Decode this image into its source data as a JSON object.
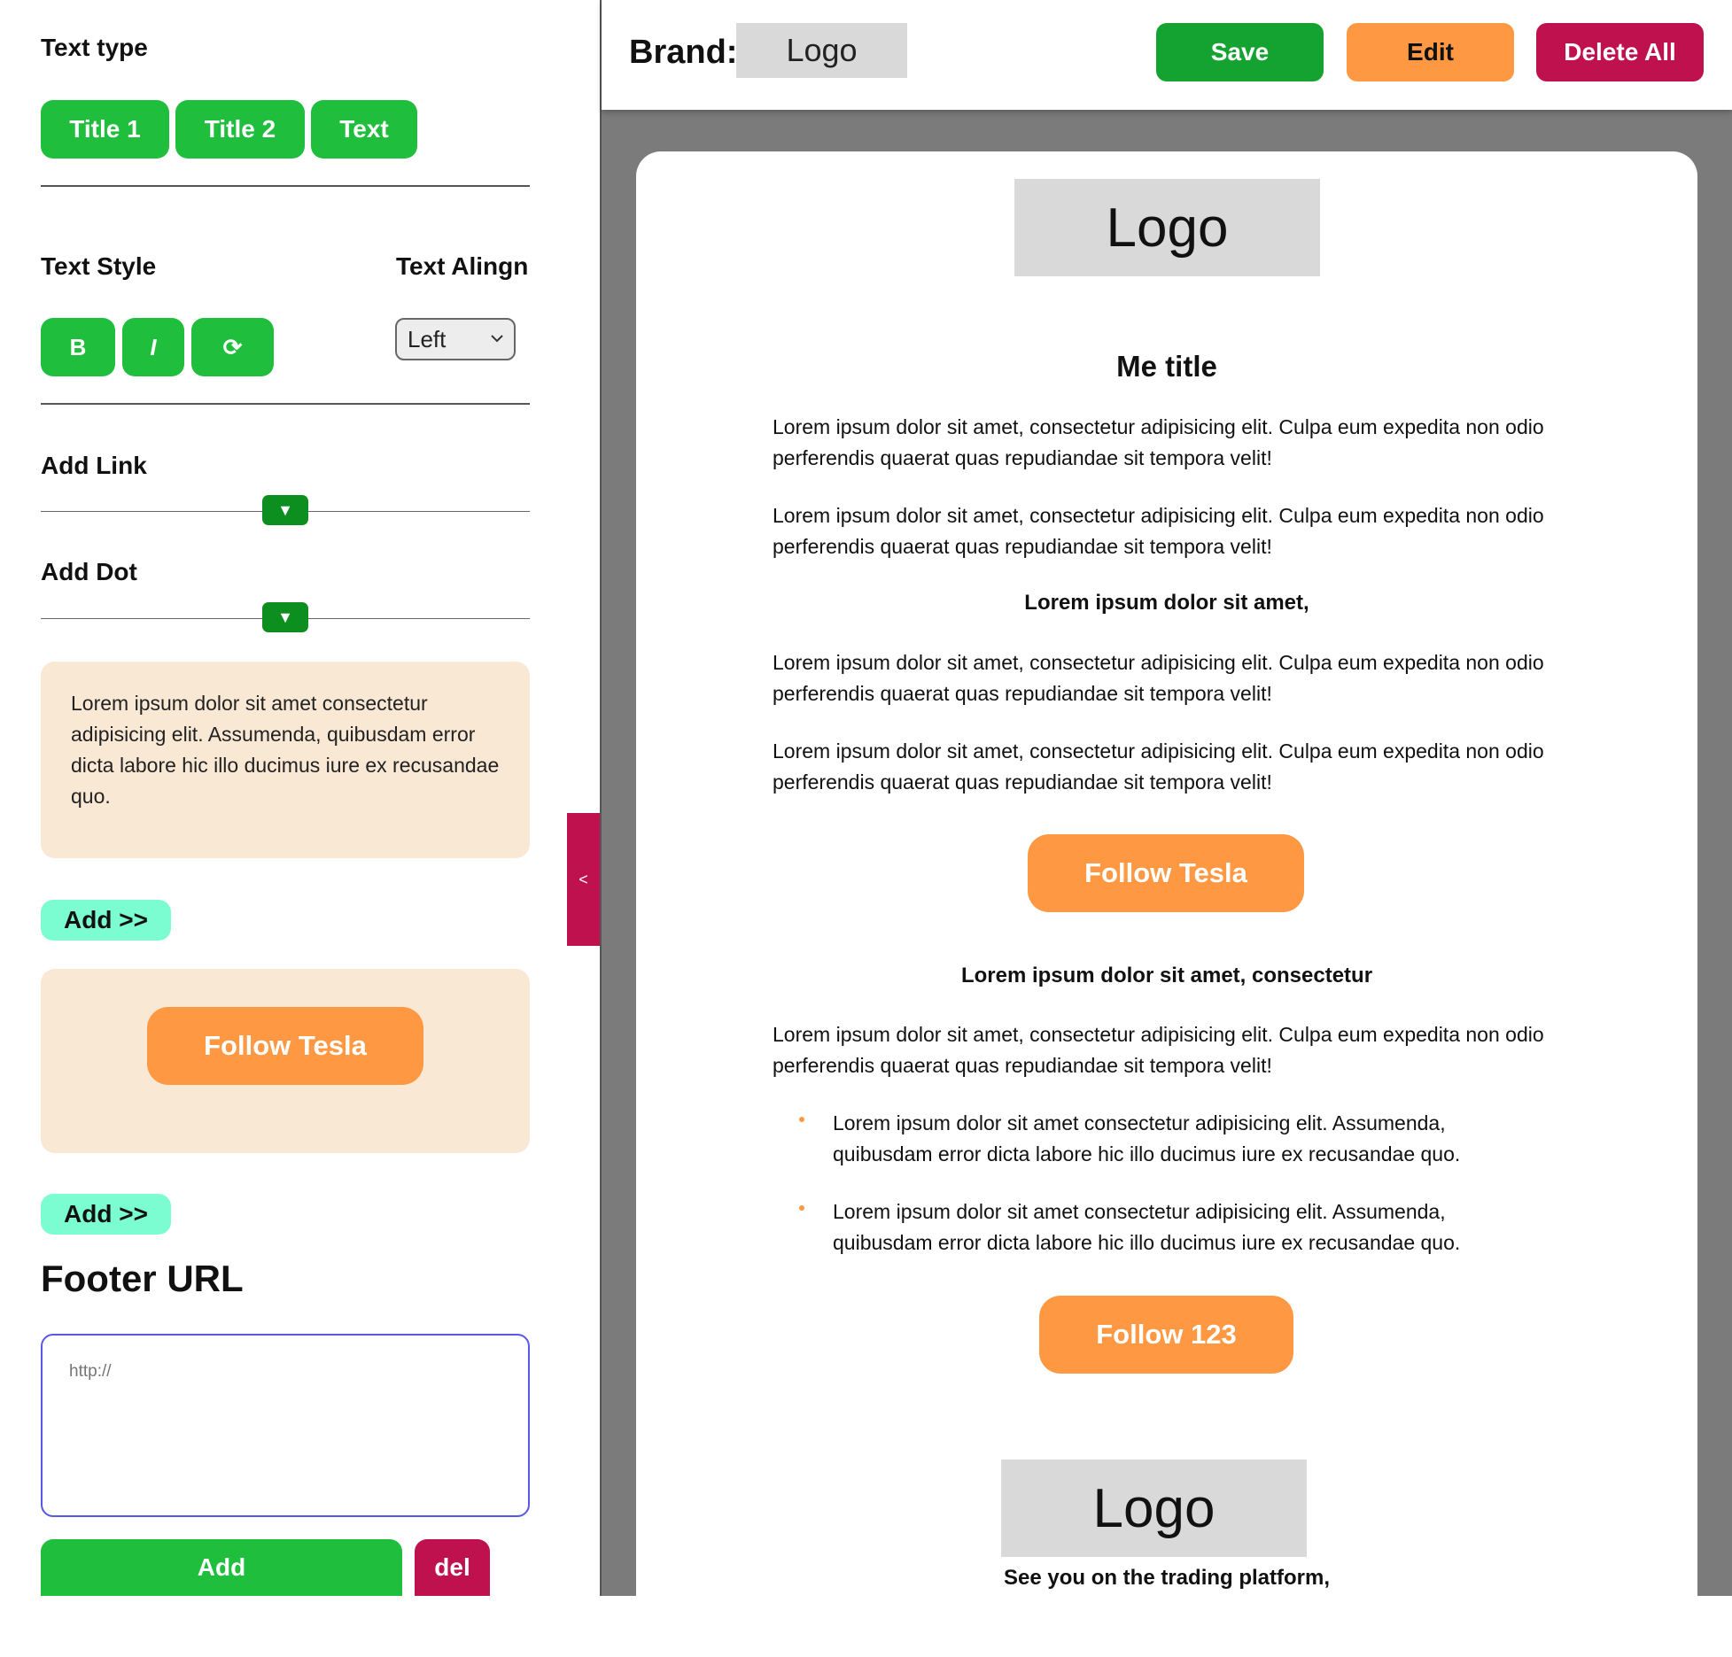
{
  "sidebar": {
    "text_type_label": "Text type",
    "text_type_buttons": [
      "Title 1",
      "Title 2",
      "Text"
    ],
    "text_style_label": "Text Style",
    "text_style_buttons": [
      "B",
      "I",
      "⟳"
    ],
    "text_align_label": "Text Alingn",
    "text_align_value": "Left",
    "add_link_label": "Add Link",
    "add_dot_label": "Add Dot",
    "slider_glyph": "▼",
    "preview_text": "Lorem ipsum dolor sit amet consectetur adipisicing elit. Assumenda, quibusdam error dicta labore hic illo ducimus iure ex recusandae quo.",
    "add_button": "Add >>",
    "preview_button": "Follow Tesla",
    "add_button_2": "Add >>",
    "footer_title": "Footer URL",
    "footer_url_placeholder": "http://",
    "footer_add": "Add",
    "footer_del": "del",
    "collapse_glyph": "<"
  },
  "header": {
    "brand_label": "Brand:",
    "brand_logo": "Logo",
    "save": "Save",
    "edit": "Edit",
    "delete_all": "Delete All"
  },
  "email": {
    "logo": "Logo",
    "title": "Me title",
    "para1": "Lorem ipsum dolor sit amet, consectetur adipisicing elit. Culpa eum expedita non odio perferendis quaerat quas repudiandae sit tempora velit!",
    "para2": "Lorem ipsum dolor sit amet, consectetur adipisicing elit. Culpa eum expedita non odio perferendis quaerat quas repudiandae sit tempora velit!",
    "subtitle1": "Lorem ipsum dolor sit amet,",
    "para3": "Lorem ipsum dolor sit amet, consectetur adipisicing elit. Culpa eum expedita non odio perferendis quaerat quas repudiandae sit tempora velit!",
    "para4": "Lorem ipsum dolor sit amet, consectetur adipisicing elit. Culpa eum expedita non odio perferendis quaerat quas repudiandae sit tempora velit!",
    "button1": "Follow Tesla",
    "subtitle2": "Lorem ipsum dolor sit amet, consectetur",
    "para5": "Lorem ipsum dolor sit amet, consectetur adipisicing elit. Culpa eum expedita non odio perferendis quaerat quas repudiandae sit tempora velit!",
    "bullets": [
      "Lorem ipsum dolor sit amet consectetur adipisicing elit. Assumenda, quibusdam error dicta labore hic illo ducimus iure ex recusandae quo.",
      "Lorem ipsum dolor sit amet consectetur adipisicing elit. Assumenda, quibusdam error dicta labore hic illo ducimus iure ex recusandae quo."
    ],
    "button2": "Follow 123",
    "footer_logo": "Logo",
    "signoff": "See you on the trading platform,"
  },
  "colors": {
    "green": "#1fbe3c",
    "dark_green": "#0d8f20",
    "orange": "#ff9842",
    "crimson": "#c0114f",
    "mint": "#7bfcd1",
    "peach": "#f9e8d4",
    "canvas_gray": "#7b7b7b",
    "save_green": "#14a330"
  }
}
